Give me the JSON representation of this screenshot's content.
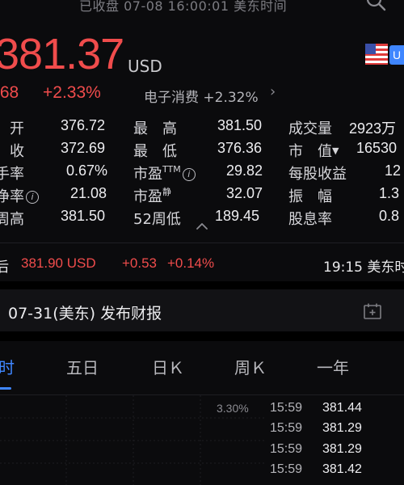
{
  "header": {
    "status": "已收盘   07-08 16:00:01 美东时间"
  },
  "quote": {
    "price": "381.37",
    "currency": "USD",
    "change": ".68",
    "change_pct": "+2.33%",
    "sector": "电子消费 +2.32%",
    "sector_chevron": "›",
    "market_badge": "U",
    "up_color": "#f04c4c",
    "accent": "#3f86ff"
  },
  "stats": {
    "rows": [
      {
        "l1": "开",
        "v1": "376.72",
        "l2": "最　高",
        "v2": "381.50",
        "l3": "成交量",
        "v3": "2923万"
      },
      {
        "l1": "收",
        "v1": "372.69",
        "l2": "最　低",
        "v2": "376.36",
        "l3": "市　值",
        "v3": "16530"
      },
      {
        "l1": "手率",
        "v1": "0.67%",
        "l2": "市盈",
        "l2_sup": "TTM",
        "v2": "29.82",
        "l3": "每股收益",
        "v3": "12"
      },
      {
        "l1": "净率",
        "v1": "21.08",
        "l2": "市盈",
        "l2_sup": "静",
        "v2": "32.07",
        "l3": "振　幅",
        "v3": "1.3"
      },
      {
        "l1": "周高",
        "v1": "381.50",
        "l2": "52周低",
        "v2": "189.45",
        "l3": "股息率",
        "v3": "0.8"
      }
    ]
  },
  "after_hours": {
    "label": "后",
    "price": "381.90 USD",
    "change": "+0.53",
    "change_pct": "+0.14%",
    "time": "19:15 美东时"
  },
  "earnings": {
    "text": "07-31(美东) 发布财报"
  },
  "tabs": [
    {
      "label": "时",
      "active": true
    },
    {
      "label": "五日",
      "active": false
    },
    {
      "label": "日Ｋ",
      "active": false
    },
    {
      "label": "周Ｋ",
      "active": false
    },
    {
      "label": "一年",
      "active": false
    }
  ],
  "chart": {
    "pct_label": "3.30%"
  },
  "ticks": [
    {
      "time": "15:59",
      "price": "381.44"
    },
    {
      "time": "15:59",
      "price": "381.29"
    },
    {
      "time": "15:59",
      "price": "381.29"
    },
    {
      "time": "15:59",
      "price": "381.42"
    }
  ],
  "icons": [
    "search-icon",
    "us-flag-icon",
    "info-icon",
    "chevron-up-icon",
    "calendar-add-icon"
  ]
}
